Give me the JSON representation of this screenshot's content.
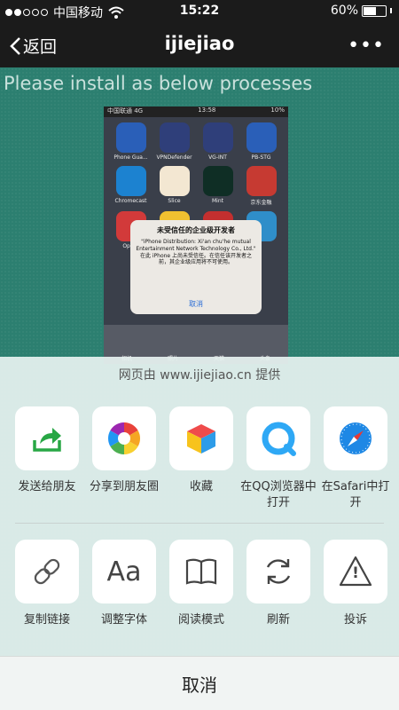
{
  "status": {
    "carrier": "中国移动",
    "time": "15:22",
    "battery": "60%",
    "battery_level": 0.6
  },
  "nav": {
    "back": "返回",
    "title": "ijiejiao",
    "more": "•••"
  },
  "page": {
    "heading": "Please install as below processes"
  },
  "screenshot": {
    "status": {
      "carrier": "中国联通  4G",
      "time": "13:58",
      "battery": "10%"
    },
    "apps": [
      {
        "name": "Phone Gua...",
        "color": "#2a5fb8"
      },
      {
        "name": "VPNDefender",
        "color": "#2f3f7a"
      },
      {
        "name": "VG-INT",
        "color": "#2f3f7a"
      },
      {
        "name": "PB-STG",
        "color": "#2a5fb8"
      },
      {
        "name": "Chromecast",
        "color": "#1c82d0"
      },
      {
        "name": "Slice",
        "color": "#f3e7d2"
      },
      {
        "name": "Mint",
        "color": "#0f2e25"
      },
      {
        "name": "京东金融",
        "color": "#c63a32"
      },
      {
        "name": "Opera",
        "color": "#d23a3a"
      },
      {
        "name": "",
        "color": "#f0c030"
      },
      {
        "name": "",
        "color": "#c32f2f"
      },
      {
        "name": "",
        "color": "#2f8ec9"
      }
    ],
    "alert": {
      "title": "未受信任的企业级开发者",
      "message": "\"iPhone Distribution: Xi'an chu'he mutual Entertainment Network Technology Co., Ltd.\" 在此 iPhone 上尚未受信任。在信任该开发者之前，其企业级应用将不可使用。",
      "button": "取消"
    },
    "dock": [
      "相机",
      "照片",
      "天猫",
      "头条"
    ]
  },
  "sheet": {
    "provider": "网页由 www.ijiejiao.cn 提供",
    "row1": [
      {
        "label": "发送给朋友",
        "icon": "send-to-friend-icon"
      },
      {
        "label": "分享到朋友圈",
        "icon": "moments-icon"
      },
      {
        "label": "收藏",
        "icon": "favorite-cube-icon"
      },
      {
        "label": "在QQ浏览器中打开",
        "icon": "qq-browser-icon"
      },
      {
        "label": "在Safari中打开",
        "icon": "safari-compass-icon"
      }
    ],
    "row2": [
      {
        "label": "复制链接",
        "icon": "link-icon"
      },
      {
        "label": "调整字体",
        "icon": "font-icon",
        "glyph": "Aa"
      },
      {
        "label": "阅读模式",
        "icon": "book-icon"
      },
      {
        "label": "刷新",
        "icon": "refresh-icon"
      },
      {
        "label": "投诉",
        "icon": "warning-icon",
        "glyph": "!"
      }
    ],
    "cancel": "取消"
  }
}
